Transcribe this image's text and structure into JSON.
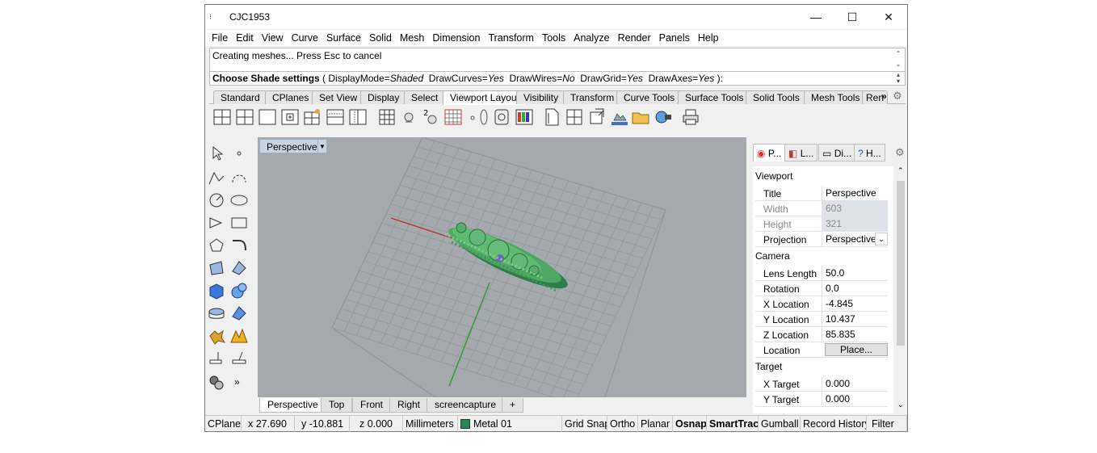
{
  "window": {
    "title": "CJC1953",
    "controls": {
      "minimize": "—",
      "maximize": "☐",
      "close": "✕"
    }
  },
  "menu": [
    "File",
    "Edit",
    "View",
    "Curve",
    "Surface",
    "Solid",
    "Mesh",
    "Dimension",
    "Transform",
    "Tools",
    "Analyze",
    "Render",
    "Panels",
    "Help"
  ],
  "command": {
    "history": "Creating meshes... Press Esc to cancel",
    "prompt": "Choose Shade settings",
    "options_prefix": " ( ",
    "opt_display_key": "DisplayMode=",
    "opt_display_val": "Shaded",
    "opt_curves_key": "DrawCurves=",
    "opt_curves_val": "Yes",
    "opt_wires_key": "DrawWires=",
    "opt_wires_val": "No",
    "opt_grid_key": "DrawGrid=",
    "opt_grid_val": "Yes",
    "opt_axes_key": "DrawAxes=",
    "opt_axes_val": "Yes",
    "options_suffix": " ):"
  },
  "toolbar_tabs": [
    "Standard",
    "CPlanes",
    "Set View",
    "Display",
    "Select",
    "Viewport Layout",
    "Visibility",
    "Transform",
    "Curve Tools",
    "Surface Tools",
    "Solid Tools",
    "Mesh Tools",
    "Ren"
  ],
  "toolbar_tabs_more": "»",
  "viewport": {
    "title": "Perspective",
    "tabs": [
      "Perspective",
      "Top",
      "Front",
      "Right",
      "screencapture"
    ],
    "add_tab": "+"
  },
  "panel": {
    "tabs": [
      "P...",
      "L...",
      "Di...",
      "H..."
    ],
    "sections": {
      "viewport": "Viewport",
      "camera": "Camera",
      "target": "Target"
    },
    "viewport_props": [
      {
        "key": "Title",
        "value": "Perspective"
      },
      {
        "key": "Width",
        "value": "603"
      },
      {
        "key": "Height",
        "value": "321"
      },
      {
        "key": "Projection",
        "value": "Perspective"
      }
    ],
    "camera_props": [
      {
        "key": "Lens Length",
        "value": "50.0"
      },
      {
        "key": "Rotation",
        "value": "0.0"
      },
      {
        "key": "X Location",
        "value": "-4.845"
      },
      {
        "key": "Y Location",
        "value": "10.437"
      },
      {
        "key": "Z Location",
        "value": "85.835"
      },
      {
        "key": "Location",
        "value": "Place..."
      }
    ],
    "target_props": [
      {
        "key": "X Target",
        "value": "0.000"
      },
      {
        "key": "Y Target",
        "value": "0.000"
      }
    ]
  },
  "status": {
    "cplane": "CPlane",
    "x": "x 27.690",
    "y": "y -10.881",
    "z": "z 0.000",
    "units": "Millimeters",
    "layer": "Metal 01",
    "layer_color": "#1f8a5a",
    "grid_snap": "Grid Snap",
    "ortho": "Ortho",
    "planar": "Planar",
    "osnap": "Osnap",
    "smarttrack": "SmartTrack",
    "gumball": "Gumball",
    "record_history": "Record History",
    "filter": "Filter"
  }
}
